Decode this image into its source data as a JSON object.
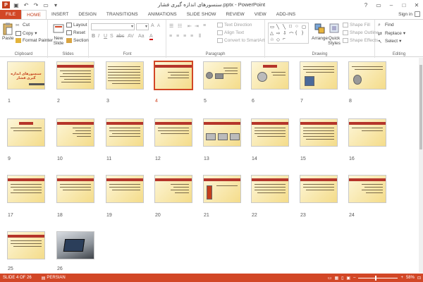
{
  "titlebar": {
    "title": "سنسورهای اندازه گیری فشار.pptx - PowerPoint",
    "window_controls": [
      "?",
      "▭",
      "–",
      "□",
      "✕"
    ]
  },
  "tabs": [
    {
      "label": "FILE"
    },
    {
      "label": "HOME"
    },
    {
      "label": "INSERT"
    },
    {
      "label": "DESIGN"
    },
    {
      "label": "TRANSITIONS"
    },
    {
      "label": "ANIMATIONS"
    },
    {
      "label": "SLIDE SHOW"
    },
    {
      "label": "REVIEW"
    },
    {
      "label": "VIEW"
    },
    {
      "label": "ADD-INS"
    }
  ],
  "signin": "Sign in",
  "ribbon": {
    "clipboard": {
      "label": "Clipboard",
      "paste": "Paste",
      "cut": "Cut",
      "copy": "Copy",
      "format_painter": "Format Painter"
    },
    "slides": {
      "label": "Slides",
      "new_slide": "New Slide",
      "layout": "Layout",
      "reset": "Reset",
      "section": "Section"
    },
    "font": {
      "label": "Font"
    },
    "paragraph": {
      "label": "Paragraph",
      "text_direction": "Text Direction",
      "align_text": "Align Text",
      "convert_smartart": "Convert to SmartArt"
    },
    "drawing": {
      "label": "Drawing",
      "arrange": "Arrange",
      "quick_styles": "Quick Styles",
      "shape_fill": "Shape Fill",
      "shape_outline": "Shape Outline",
      "shape_effects": "Shape Effects"
    },
    "editing": {
      "label": "Editing",
      "find": "Find",
      "replace": "Replace",
      "select": "Select"
    }
  },
  "slides": {
    "selected": 4,
    "numbers": [
      "1",
      "2",
      "3",
      "4",
      "5",
      "6",
      "7",
      "8",
      "9",
      "10",
      "11",
      "12",
      "13",
      "14",
      "15",
      "16",
      "17",
      "18",
      "19",
      "20",
      "21",
      "22",
      "23",
      "24",
      "25",
      "26"
    ],
    "slide1_title": "سنسورهای اندازه گیری فشار"
  },
  "statusbar": {
    "slide_info": "SLIDE 4 OF 26",
    "language": "PERSIAN",
    "zoom": "58%"
  },
  "colors": {
    "accent": "#d24726",
    "slide_bg": "#f4dc8a",
    "slide_bar": "#b5352a"
  }
}
